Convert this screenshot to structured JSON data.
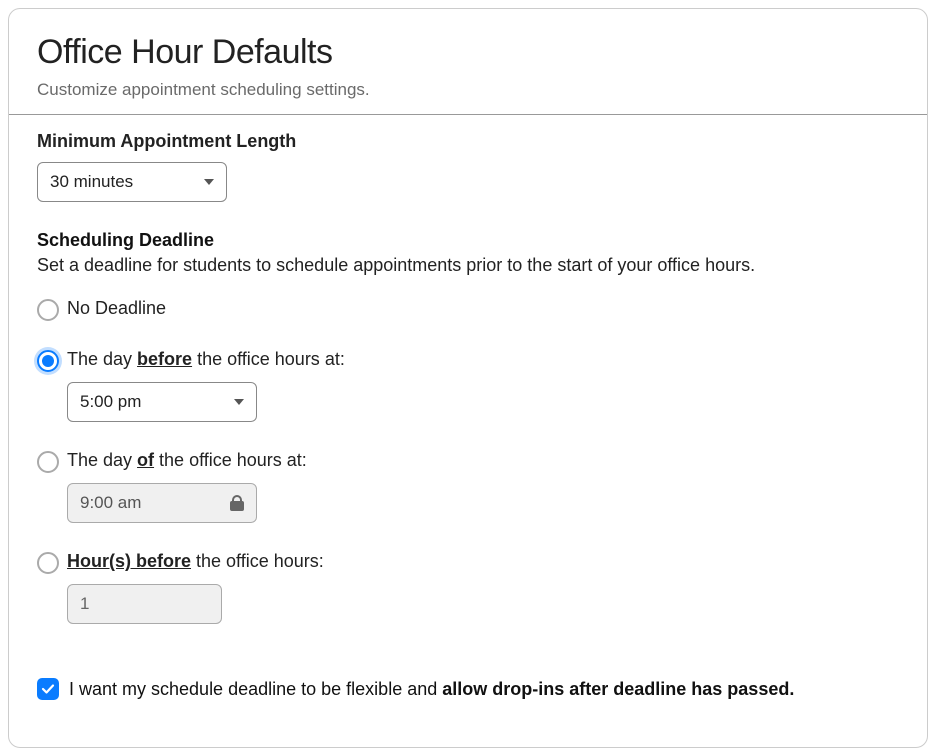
{
  "header": {
    "title": "Office Hour Defaults",
    "subtitle": "Customize appointment scheduling settings."
  },
  "min_length": {
    "label": "Minimum Appointment Length",
    "value": "30 minutes"
  },
  "deadline": {
    "label": "Scheduling Deadline",
    "desc": "Set a deadline for students to schedule appointments prior to the start of your office hours.",
    "options": {
      "none": {
        "label": "No Deadline"
      },
      "day_before": {
        "prefix": "The day ",
        "emph": "before",
        "suffix": " the office hours at:",
        "value": "5:00 pm"
      },
      "day_of": {
        "prefix": "The day ",
        "emph": "of",
        "suffix": " the office hours at:",
        "value": "9:00 am"
      },
      "hours_before": {
        "emph": "Hour(s) before",
        "suffix": " the office hours:",
        "value": "1"
      }
    }
  },
  "flex": {
    "prefix": "I want my schedule deadline to be flexible and ",
    "bold": "allow drop-ins after deadline has passed."
  }
}
